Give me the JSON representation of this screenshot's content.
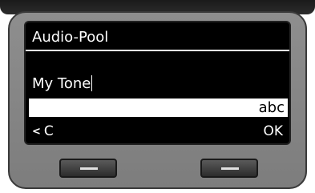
{
  "screen": {
    "title": "Audio-Pool",
    "entry_value": "My Tone",
    "input_mode": "abc"
  },
  "softkeys": {
    "left_label": "C",
    "left_icon": "back-arrow-icon",
    "right_label": "OK"
  },
  "colors": {
    "screen_bg": "#000000",
    "screen_fg": "#ffffff",
    "device_body": "#8a8a8a"
  }
}
